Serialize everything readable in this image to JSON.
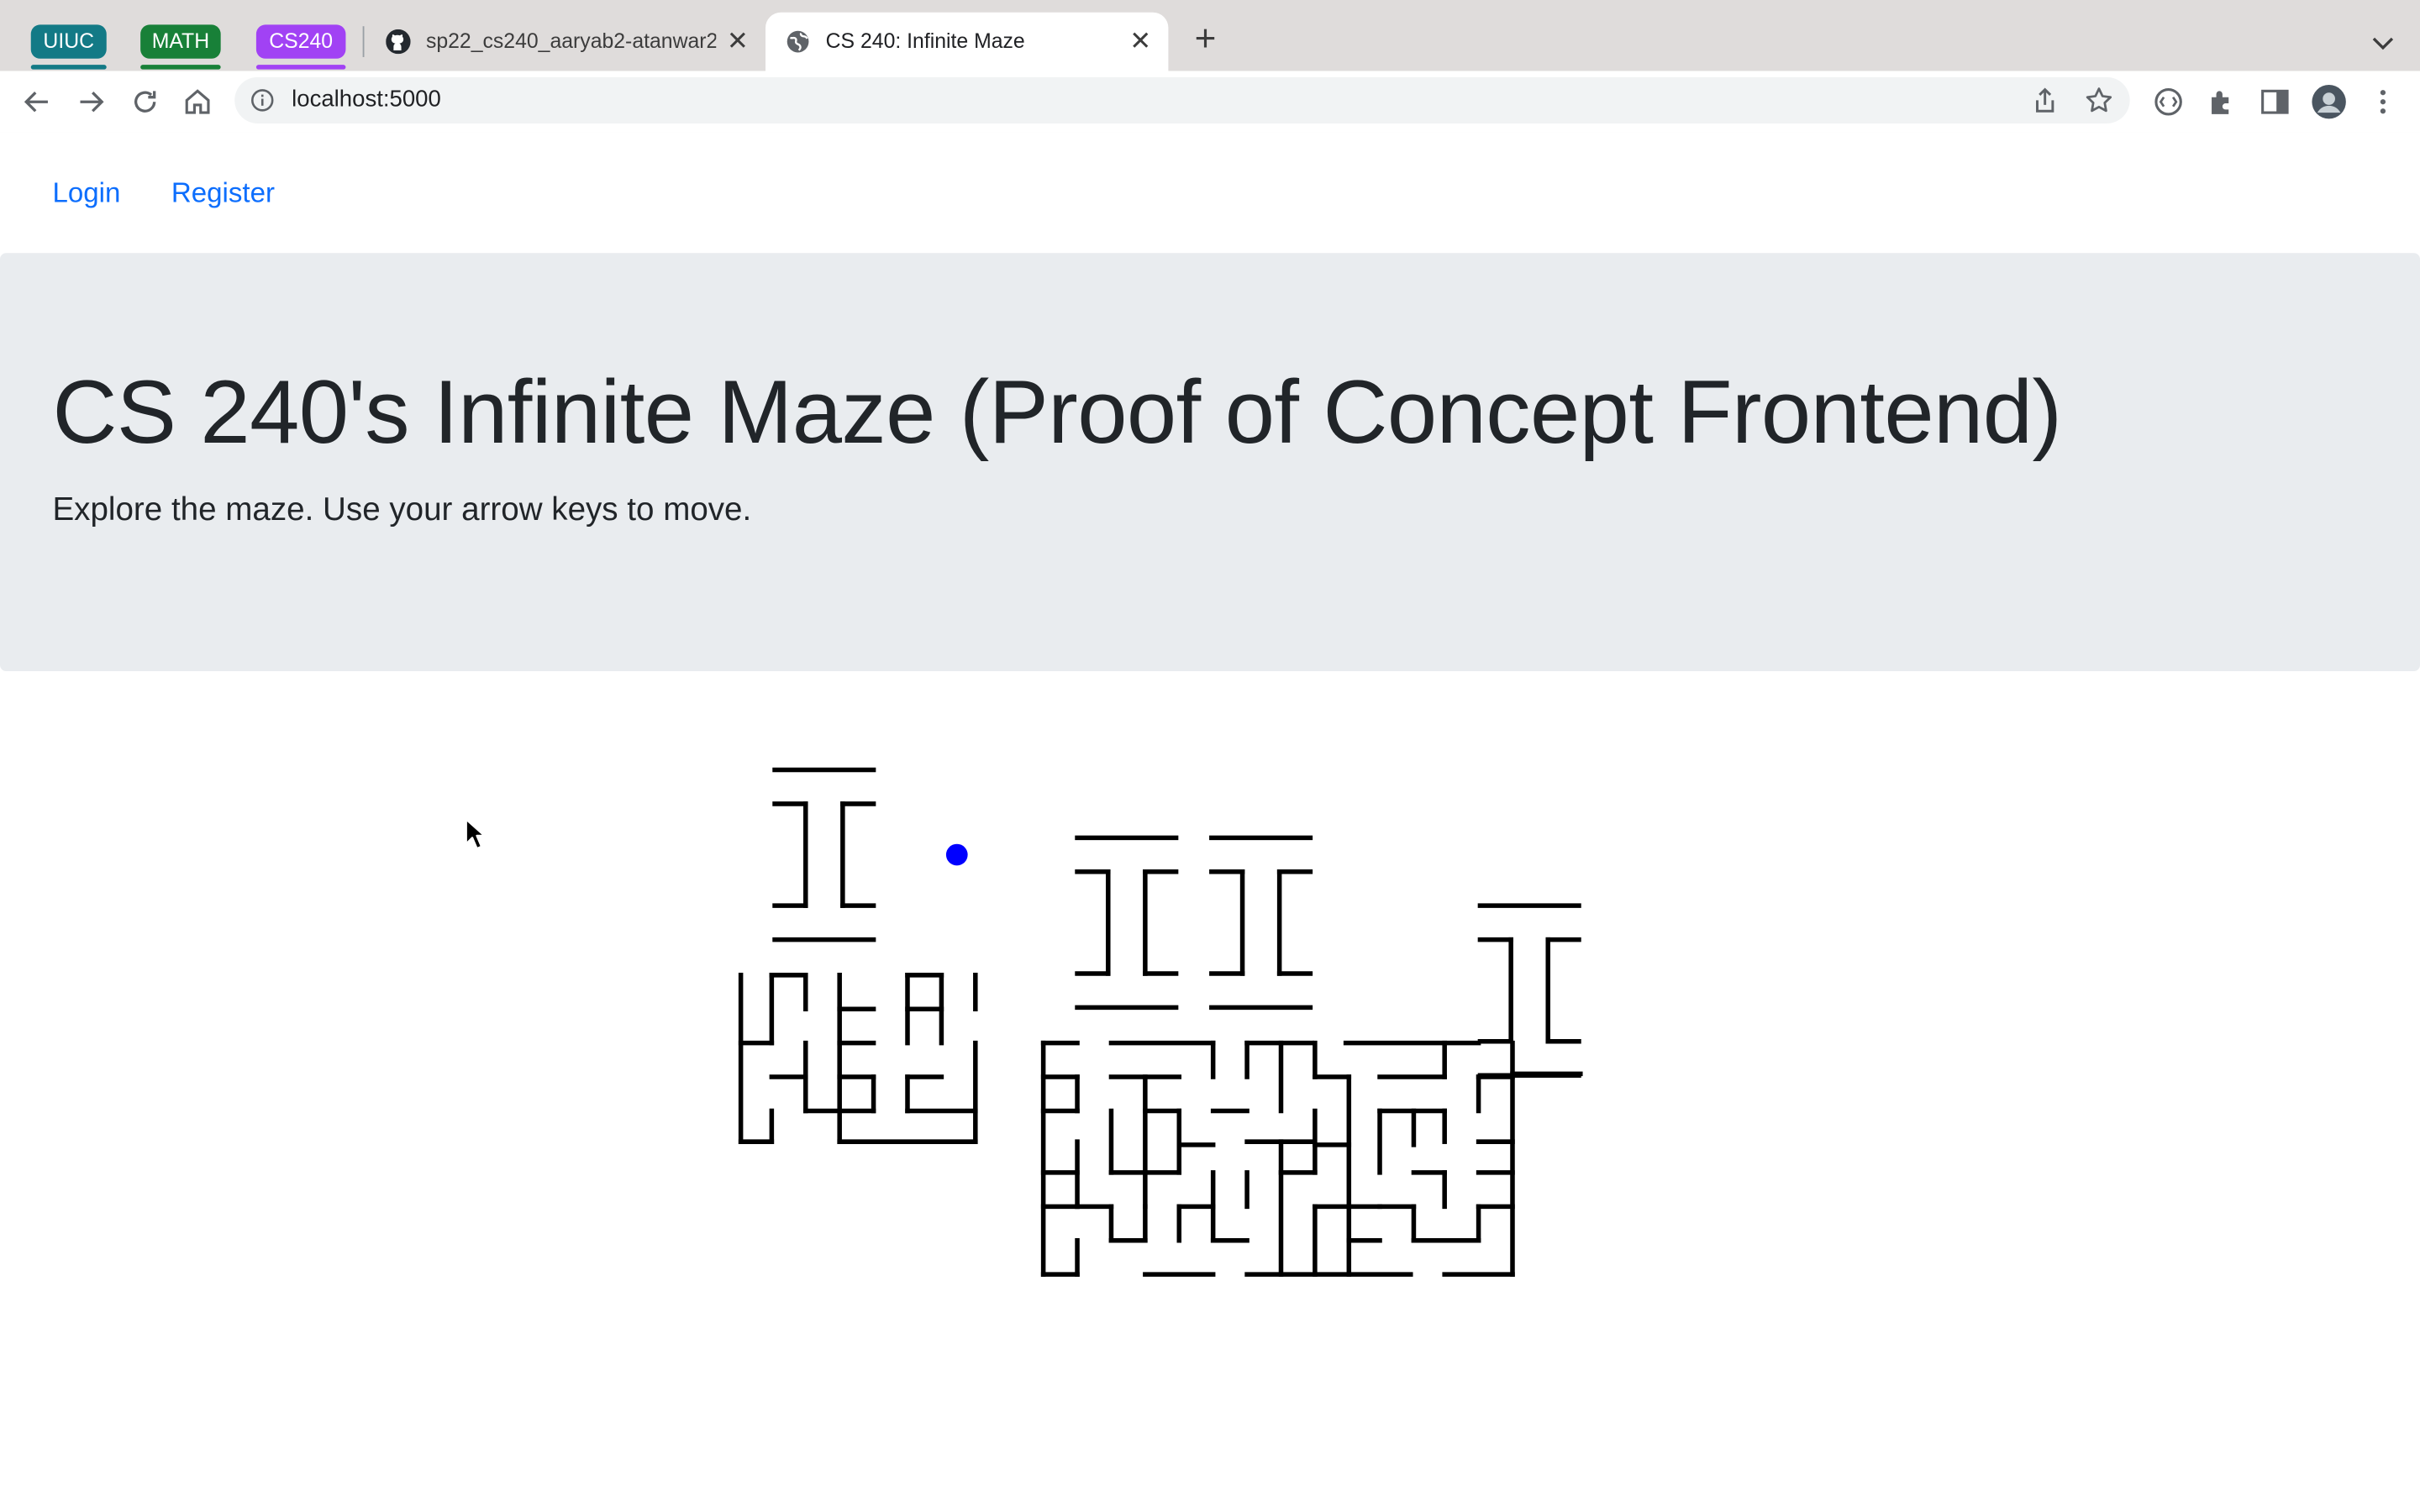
{
  "browser": {
    "tab_groups": [
      {
        "label": "UIUC",
        "color": "#137a86"
      },
      {
        "label": "MATH",
        "color": "#188038"
      },
      {
        "label": "CS240",
        "color": "#a142f4"
      }
    ],
    "tabs": [
      {
        "title": "sp22_cs240_aaryab2-atanwar2",
        "favicon": "github-icon"
      },
      {
        "title": "CS 240: Infinite Maze",
        "favicon": "globe-icon",
        "active": true
      }
    ],
    "url": "localhost:5000"
  },
  "nav": {
    "login": "Login",
    "register": "Register"
  },
  "hero": {
    "title": "CS 240's Infinite Maze (Proof of Concept Frontend)",
    "lead_bold": "Explore the maze.",
    "lead_rest": " Use your arrow keys to move."
  },
  "maze": {
    "wall_color": "#000000",
    "player_color": "#0000ff"
  }
}
